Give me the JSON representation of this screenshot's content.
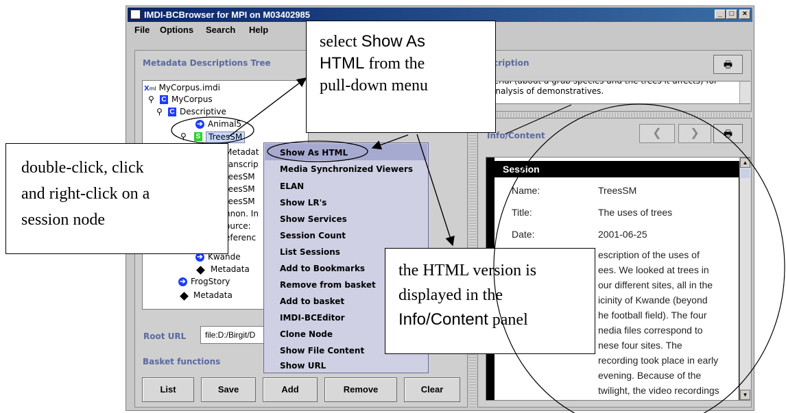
{
  "window": {
    "title": "IMDI-BCBrowser for MPI on M03402985",
    "controls": [
      "_",
      "□",
      "×"
    ]
  },
  "menu": [
    "File",
    "Options",
    "Search",
    "Help"
  ],
  "left_panel": {
    "title": "Metadata Descriptions Tree",
    "tree": [
      {
        "label": "MyCorpus.imdi",
        "icon": "xml-icon"
      },
      {
        "label": "MyCorpus",
        "icon": "corpus-icon"
      },
      {
        "label": "Descriptive",
        "icon": "corpus-icon"
      },
      {
        "label": "Animal5",
        "icon": "arrow-icon"
      },
      {
        "label": "TreesSM",
        "icon": "session-icon"
      },
      {
        "label": "Metadat",
        "icon": "none"
      },
      {
        "label": "ranscrip",
        "icon": "none"
      },
      {
        "label": "reesSM",
        "icon": "none"
      },
      {
        "label": "reesSM",
        "icon": "none"
      },
      {
        "label": "reesSM",
        "icon": "none"
      },
      {
        "label": "nnon. In",
        "icon": "none"
      },
      {
        "label": "ource:",
        "icon": "none"
      },
      {
        "label": "eferenc",
        "icon": "none"
      },
      {
        "label": "Kwande",
        "icon": "arrow-icon"
      },
      {
        "label": "Metadata",
        "icon": "diamond-icon"
      },
      {
        "label": "FrogStory",
        "icon": "arrow-icon"
      },
      {
        "label": "Metadata",
        "icon": "diamond-icon"
      }
    ],
    "root_url_label": "Root URL",
    "root_url_value": "file:D:/Birgit/D",
    "basket_label": "Basket functions",
    "basket_buttons": [
      "List",
      "Save",
      "Add",
      "Remove",
      "Clear"
    ]
  },
  "description_panel": {
    "title": "scription",
    "text_line1": "terial (about a grub species and the trees it affects) for",
    "text_line2": "analysis of demonstratives."
  },
  "info_panel": {
    "title": "Info/Content",
    "session_header": "Session",
    "fields": [
      {
        "label": "Name:",
        "value": "TreesSM"
      },
      {
        "label": "Title:",
        "value": "The uses of trees"
      },
      {
        "label": "Date:",
        "value": "2001-06-25"
      }
    ],
    "description_lines": [
      "escription of the uses of",
      "ees. We looked at trees in",
      "our different sites, all in the",
      "icinity of Kwande (beyond",
      "he football field). The four",
      "nedia files correspond to",
      "nese four sites. The",
      "recording took place in early",
      "evening. Because of the",
      "twilight, the video recordings"
    ]
  },
  "context_menu": [
    "Show As HTML",
    "Media Synchronized Viewers",
    "ELAN",
    "Show LR's",
    "Show Services",
    "Session Count",
    "List Sessions",
    "Add to Bookmarks",
    "Remove from basket",
    "Add to basket",
    "IMDI-BCEditor",
    "Clone Node",
    "Show File Content",
    "Show URL"
  ],
  "callouts": {
    "top": {
      "l1a": "select ",
      "l1b": "Show As",
      "l2a": "HTML",
      "l2b": " from the",
      "l3": "pull-down menu"
    },
    "left": {
      "l1": "double-click, click",
      "l2": "and right-click on a",
      "l3": "session node"
    },
    "bottom": {
      "l1": "the HTML version is",
      "l2": "displayed in the",
      "l3a": "Info/Content",
      "l3b": " panel"
    }
  },
  "colors": {
    "title_bar": "#0a246a",
    "panel_title": "#5a6aa0",
    "session_green": "#2fd02f",
    "corpus_blue": "#1a3cff"
  }
}
